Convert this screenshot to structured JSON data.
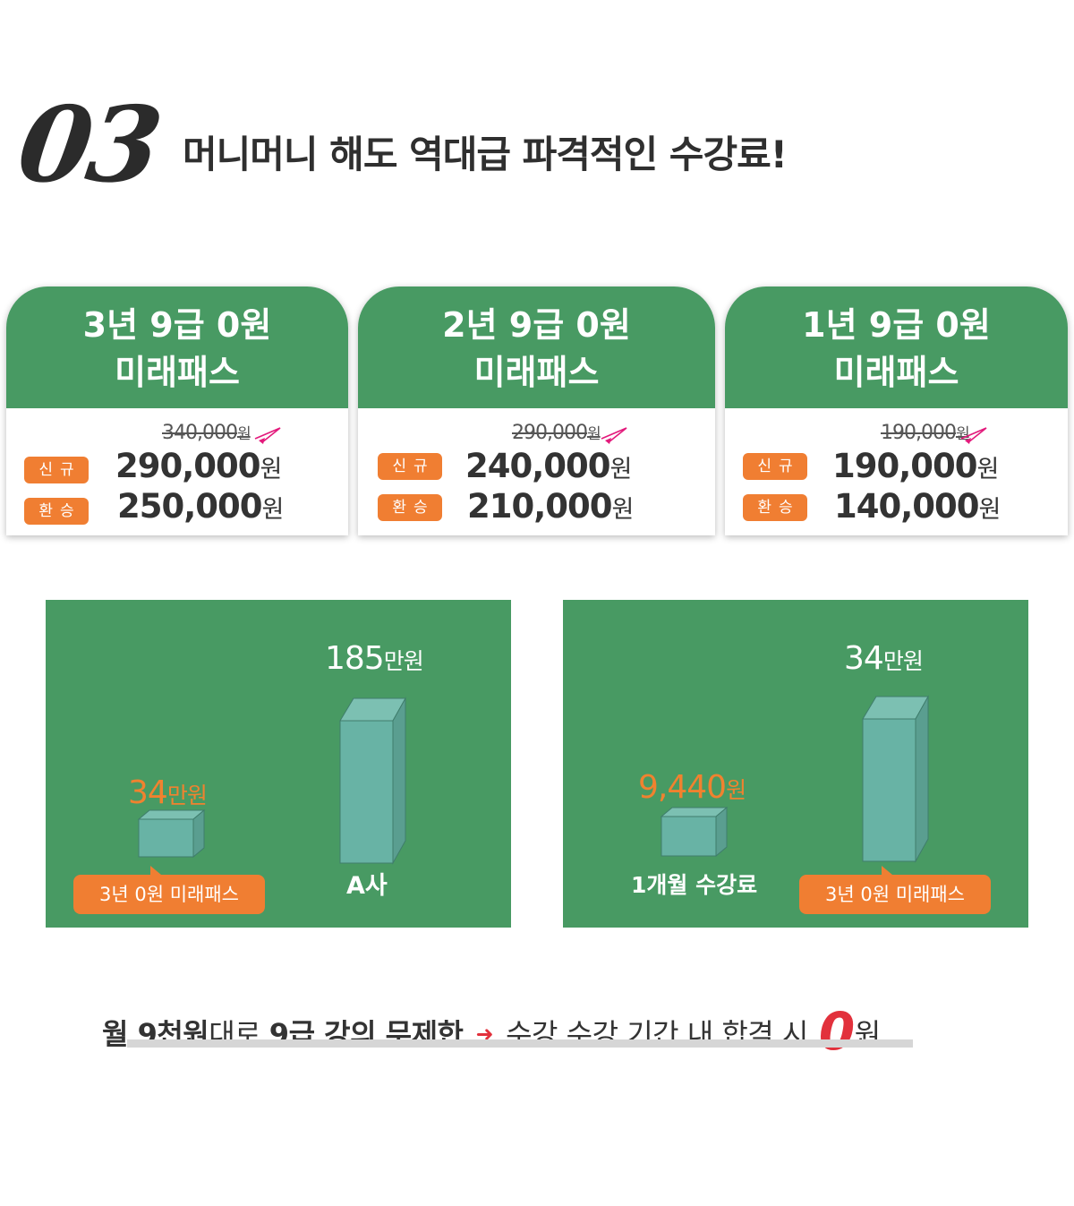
{
  "heading": {
    "number": "03",
    "title": "머니머니 해도 역대급 파격적인 수강료!"
  },
  "cards": [
    {
      "title_line1": "3년 9급 0원",
      "title_line2": "미래패스",
      "original_price": "340,000",
      "original_unit": "원",
      "rows": [
        {
          "label": "신규",
          "price": "290,000",
          "unit": "원"
        },
        {
          "label": "환승",
          "price": "250,000",
          "unit": "원"
        }
      ]
    },
    {
      "title_line1": "2년 9급 0원",
      "title_line2": "미래패스",
      "original_price": "290,000",
      "original_unit": "원",
      "rows": [
        {
          "label": "신규",
          "price": "240,000",
          "unit": "원"
        },
        {
          "label": "환승",
          "price": "210,000",
          "unit": "원"
        }
      ]
    },
    {
      "title_line1": "1년 9급 0원",
      "title_line2": "미래패스",
      "original_price": "190,000",
      "original_unit": "원",
      "rows": [
        {
          "label": "신규",
          "price": "190,000",
          "unit": "원"
        },
        {
          "label": "환승",
          "price": "140,000",
          "unit": "원"
        }
      ]
    }
  ],
  "comparisons": [
    {
      "small_value": "34",
      "small_unit": "만원",
      "small_tag": "3년 0원 미래패스",
      "big_value": "185",
      "big_unit": "만원",
      "big_label": "A사"
    },
    {
      "small_value": "9,440",
      "small_unit": "원",
      "small_label": "1개월 수강료",
      "big_value": "34",
      "big_unit": "만원",
      "big_tag": "3년 0원 미래패스"
    }
  ],
  "bottom": {
    "part1": "월 9천원",
    "part2": "대로 ",
    "part3": "9급 강의 무제한",
    "arrow": "➜",
    "part4": "수강 수강 기간 내 합격 시",
    "zero": "0",
    "unit": "원"
  },
  "colors": {
    "green": "#489a63",
    "orange": "#f07e32",
    "box_face": "#68b3a5",
    "red": "#e2313c"
  }
}
